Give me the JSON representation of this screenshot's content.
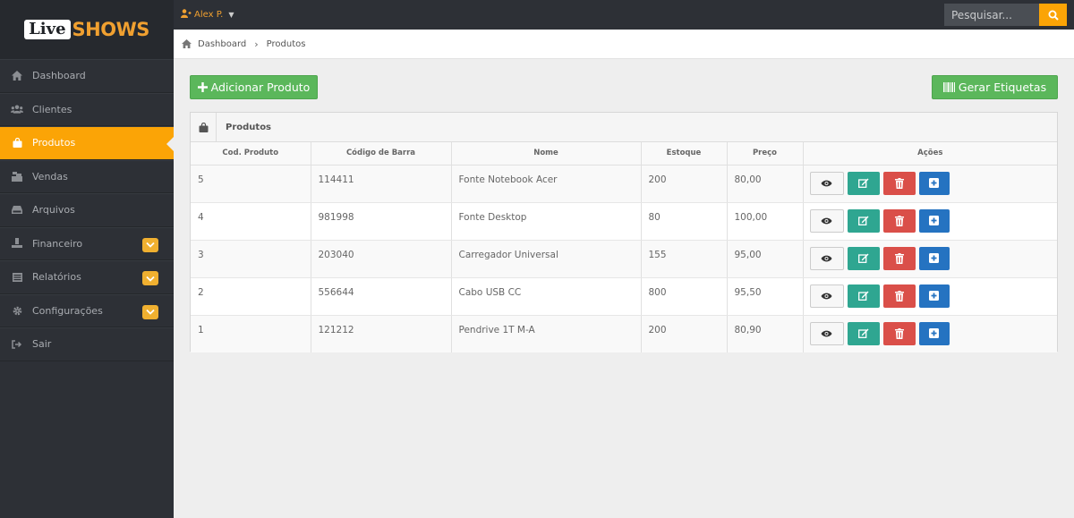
{
  "brand": {
    "logo_part1": "Live",
    "logo_part2": "SHOWS"
  },
  "topbar": {
    "user_name": "Alex P.",
    "search_placeholder": "Pesquisar...",
    "icons": {
      "user": "user-icon",
      "search": "search-icon"
    }
  },
  "sidebar": {
    "items": [
      {
        "label": "Dashboard",
        "icon": "home-icon",
        "active": false,
        "badge": false
      },
      {
        "label": "Clientes",
        "icon": "users-icon",
        "active": false,
        "badge": false
      },
      {
        "label": "Produtos",
        "icon": "shopping-bag-icon",
        "active": true,
        "badge": false
      },
      {
        "label": "Vendas",
        "icon": "cart-icon",
        "active": false,
        "badge": false
      },
      {
        "label": "Arquivos",
        "icon": "hdd-icon",
        "active": false,
        "badge": false
      },
      {
        "label": "Financeiro",
        "icon": "money-icon",
        "active": false,
        "badge": true
      },
      {
        "label": "Relatórios",
        "icon": "list-icon",
        "active": false,
        "badge": true
      },
      {
        "label": "Configurações",
        "icon": "cog-icon",
        "active": false,
        "badge": true
      },
      {
        "label": "Sair",
        "icon": "sign-out-icon",
        "active": false,
        "badge": false
      }
    ]
  },
  "breadcrumb": {
    "home": "Dashboard",
    "current": "Produtos"
  },
  "actions": {
    "add_label": "Adicionar Produto",
    "labels_label": "Gerar Etiquetas"
  },
  "panel": {
    "title": "Produtos",
    "columns": [
      "Cod. Produto",
      "Código de Barra",
      "Nome",
      "Estoque",
      "Preço",
      "Ações"
    ],
    "rows": [
      {
        "cod": "5",
        "barcode": "114411",
        "name": "Fonte Notebook Acer",
        "stock": "200",
        "price": "80,00"
      },
      {
        "cod": "4",
        "barcode": "981998",
        "name": "Fonte Desktop",
        "stock": "80",
        "price": "100,00"
      },
      {
        "cod": "3",
        "barcode": "203040",
        "name": "Carregador Universal",
        "stock": "155",
        "price": "95,00"
      },
      {
        "cod": "2",
        "barcode": "556644",
        "name": "Cabo USB CC",
        "stock": "800",
        "price": "95,50"
      },
      {
        "cod": "1",
        "barcode": "121212",
        "name": "Pendrive 1T M-A",
        "stock": "200",
        "price": "80,90"
      }
    ]
  },
  "colors": {
    "sidebar_bg": "#2d3036",
    "accent_orange": "#fba406",
    "green": "#5bb75b",
    "teal": "#2fa691",
    "red": "#da4f49",
    "blue": "#2573c1"
  }
}
